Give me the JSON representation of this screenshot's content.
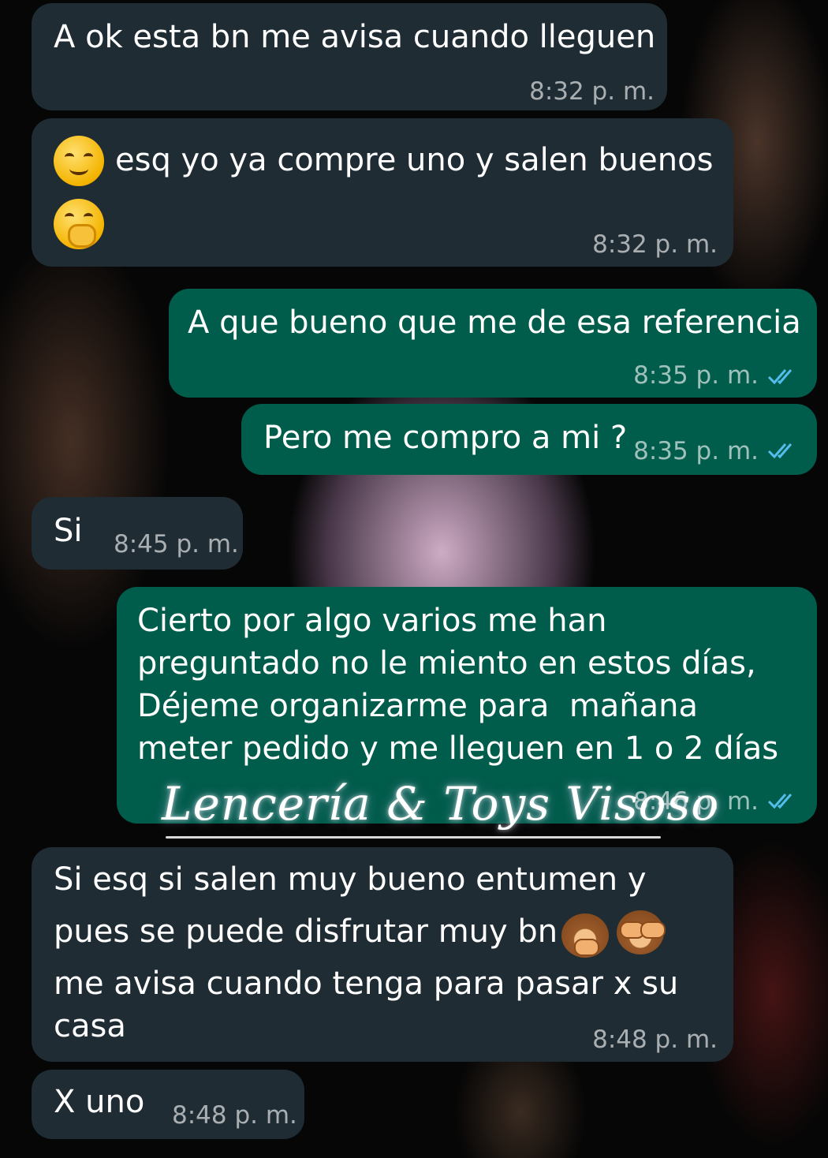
{
  "messages": [
    {
      "direction": "in",
      "text": "A ok esta bn me avisa cuando lleguen",
      "time": "8:32 p. m."
    },
    {
      "direction": "in",
      "text": "esq yo ya compre uno y salen buenos",
      "emojis": [
        "smiling-face-emoji",
        "face-with-hand-over-mouth-emoji"
      ],
      "time": "8:32 p. m."
    },
    {
      "direction": "out",
      "text": "A que bueno que me de esa referencia",
      "time": "8:35 p. m.",
      "status": "read"
    },
    {
      "direction": "out",
      "text": "Pero me compro a mi ?",
      "time": "8:35 p. m.",
      "status": "read"
    },
    {
      "direction": "in",
      "text": "Si",
      "time": "8:45 p. m."
    },
    {
      "direction": "out",
      "lines": [
        "Cierto por algo varios me han",
        "preguntado no le miento en estos días,",
        "Déjeme organizarme para  mañana",
        "meter pedido y me lleguen en 1 o 2 días"
      ],
      "time": "8:46 p. m.",
      "status": "read"
    },
    {
      "direction": "in",
      "lines": [
        "Si esq si salen muy bueno entumen y",
        "pues se puede disfrutar muy bn",
        "me avisa cuando tenga para pasar x su",
        "casa"
      ],
      "emojis": [
        "speak-no-evil-monkey-emoji",
        "see-no-evil-monkey-emoji"
      ],
      "time": "8:48 p. m."
    },
    {
      "direction": "in",
      "text": "X uno",
      "time": "8:48 p. m."
    }
  ],
  "watermark": {
    "text": "Lencería & Toys Visoso"
  },
  "colors": {
    "incoming_bubble": "#1f2c34",
    "outgoing_bubble": "#005c4b",
    "read_ticks": "#53bdeb",
    "text": "#ffffff"
  }
}
